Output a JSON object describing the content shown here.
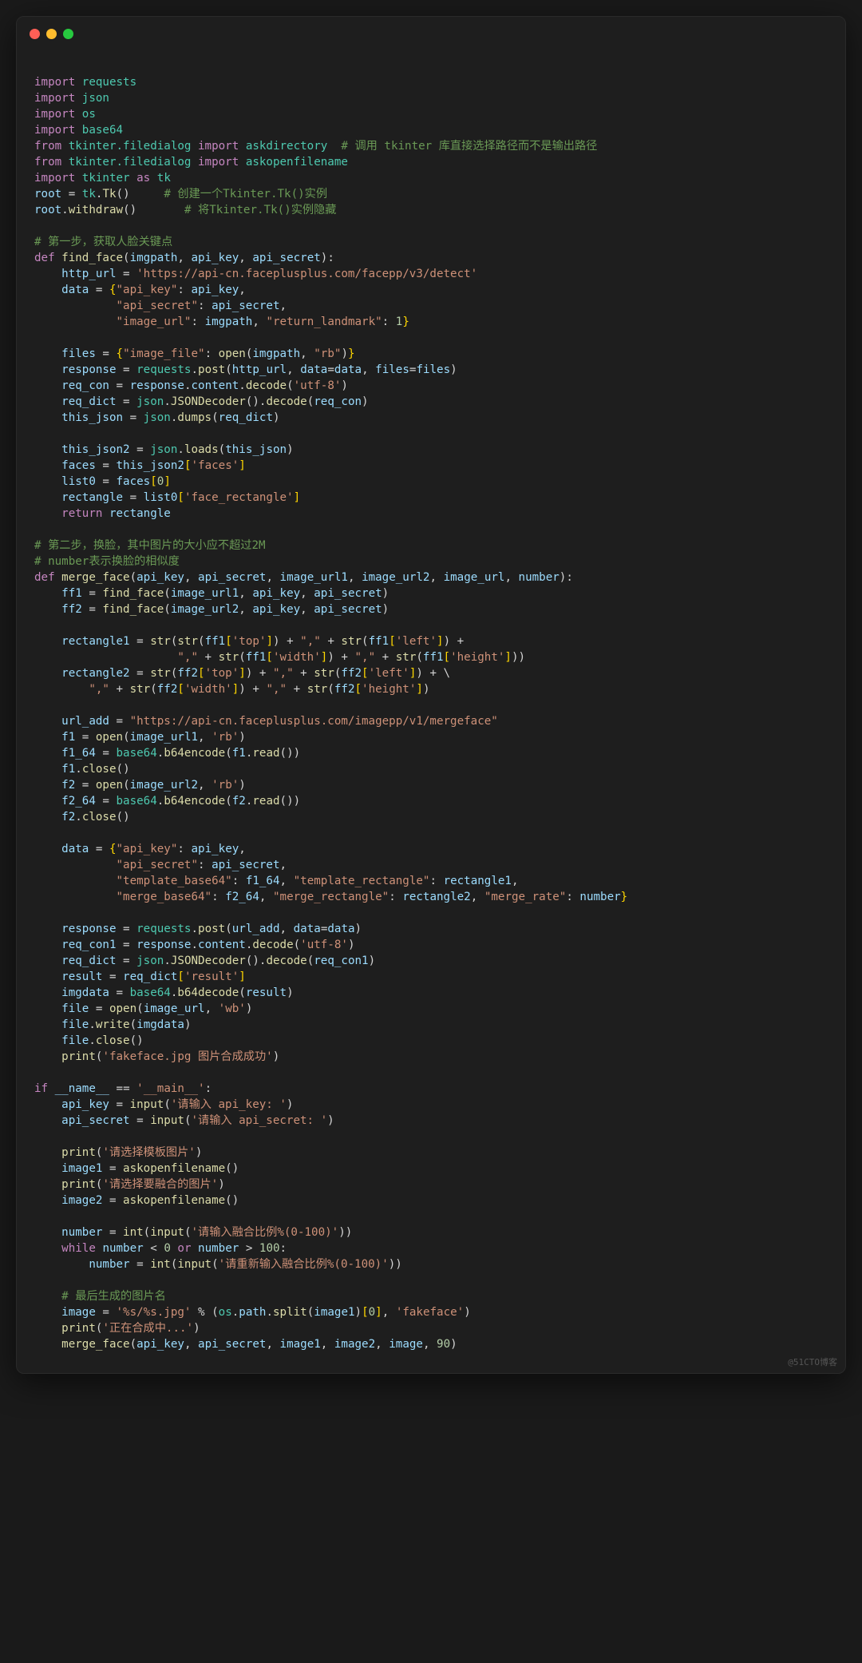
{
  "window": {
    "traffic_lights": [
      "red",
      "yellow",
      "green"
    ]
  },
  "watermark": "@51CTO博客",
  "code_lines": [
    "",
    "<span class='kw'>import</span> <span class='mod'>requests</span>",
    "<span class='kw'>import</span> <span class='mod'>json</span>",
    "<span class='kw'>import</span> <span class='mod'>os</span>",
    "<span class='kw'>import</span> <span class='mod'>base64</span>",
    "<span class='kw'>from</span> <span class='mod'>tkinter.filedialog</span> <span class='kw'>import</span> <span class='mod'>askdirectory</span>  <span class='cmt'># 调用 tkinter 库直接选择路径而不是输出路径</span>",
    "<span class='kw'>from</span> <span class='mod'>tkinter.filedialog</span> <span class='kw'>import</span> <span class='mod'>askopenfilename</span>",
    "<span class='kw'>import</span> <span class='mod'>tkinter</span> <span class='kw'>as</span> <span class='mod'>tk</span>",
    "<span class='var'>root</span> = <span class='mod'>tk</span>.<span class='fn'>Tk</span>()     <span class='cmt'># 创建一个Tkinter.Tk()实例</span>",
    "<span class='var'>root</span>.<span class='fn'>withdraw</span>()       <span class='cmt'># 将Tkinter.Tk()实例隐藏</span>",
    "",
    "<span class='cmt'># 第一步，获取人脸关键点</span>",
    "<span class='kw'>def</span> <span class='fn'>find_face</span>(<span class='var'>imgpath</span>, <span class='var'>api_key</span>, <span class='var'>api_secret</span>):",
    "    <span class='var'>http_url</span> = <span class='str'>'https://api-cn.faceplusplus.com/facepp/v3/detect'</span>",
    "    <span class='var'>data</span> = <span class='pun'>{</span><span class='str'>\"api_key\"</span>: <span class='var'>api_key</span>,",
    "            <span class='str'>\"api_secret\"</span>: <span class='var'>api_secret</span>,",
    "            <span class='str'>\"image_url\"</span>: <span class='var'>imgpath</span>, <span class='str'>\"return_landmark\"</span>: <span class='num'>1</span><span class='pun'>}</span>",
    "",
    "    <span class='var'>files</span> = <span class='pun'>{</span><span class='str'>\"image_file\"</span>: <span class='fn'>open</span>(<span class='var'>imgpath</span>, <span class='str'>\"rb\"</span>)<span class='pun'>}</span>",
    "    <span class='var'>response</span> = <span class='mod'>requests</span>.<span class='fn'>post</span>(<span class='var'>http_url</span>, <span class='var'>data</span>=<span class='var'>data</span>, <span class='var'>files</span>=<span class='var'>files</span>)",
    "    <span class='var'>req_con</span> = <span class='var'>response</span>.<span class='var'>content</span>.<span class='fn'>decode</span>(<span class='str'>'utf-8'</span>)",
    "    <span class='var'>req_dict</span> = <span class='mod'>json</span>.<span class='fn'>JSONDecoder</span>().<span class='fn'>decode</span>(<span class='var'>req_con</span>)",
    "    <span class='var'>this_json</span> = <span class='mod'>json</span>.<span class='fn'>dumps</span>(<span class='var'>req_dict</span>)",
    "",
    "    <span class='var'>this_json2</span> = <span class='mod'>json</span>.<span class='fn'>loads</span>(<span class='var'>this_json</span>)",
    "    <span class='var'>faces</span> = <span class='var'>this_json2</span><span class='pun'>[</span><span class='str'>'faces'</span><span class='pun'>]</span>",
    "    <span class='var'>list0</span> = <span class='var'>faces</span><span class='pun'>[</span><span class='num'>0</span><span class='pun'>]</span>",
    "    <span class='var'>rectangle</span> = <span class='var'>list0</span><span class='pun'>[</span><span class='str'>'face_rectangle'</span><span class='pun'>]</span>",
    "    <span class='kw'>return</span> <span class='var'>rectangle</span>",
    "",
    "<span class='cmt'># 第二步，换脸，其中图片的大小应不超过2M</span>",
    "<span class='cmt'># number表示换脸的相似度</span>",
    "<span class='kw'>def</span> <span class='fn'>merge_face</span>(<span class='var'>api_key</span>, <span class='var'>api_secret</span>, <span class='var'>image_url1</span>, <span class='var'>image_url2</span>, <span class='var'>image_url</span>, <span class='var'>number</span>):",
    "    <span class='var'>ff1</span> = <span class='fn'>find_face</span>(<span class='var'>image_url1</span>, <span class='var'>api_key</span>, <span class='var'>api_secret</span>)",
    "    <span class='var'>ff2</span> = <span class='fn'>find_face</span>(<span class='var'>image_url2</span>, <span class='var'>api_key</span>, <span class='var'>api_secret</span>)",
    "",
    "    <span class='var'>rectangle1</span> = <span class='fn'>str</span>(<span class='fn'>str</span>(<span class='var'>ff1</span><span class='pun'>[</span><span class='str'>'top'</span><span class='pun'>]</span>) + <span class='str'>\",\"</span> + <span class='fn'>str</span>(<span class='var'>ff1</span><span class='pun'>[</span><span class='str'>'left'</span><span class='pun'>]</span>) +",
    "                     <span class='str'>\",\"</span> + <span class='fn'>str</span>(<span class='var'>ff1</span><span class='pun'>[</span><span class='str'>'width'</span><span class='pun'>]</span>) + <span class='str'>\",\"</span> + <span class='fn'>str</span>(<span class='var'>ff1</span><span class='pun'>[</span><span class='str'>'height'</span><span class='pun'>]</span>))",
    "    <span class='var'>rectangle2</span> = <span class='fn'>str</span>(<span class='var'>ff2</span><span class='pun'>[</span><span class='str'>'top'</span><span class='pun'>]</span>) + <span class='str'>\",\"</span> + <span class='fn'>str</span>(<span class='var'>ff2</span><span class='pun'>[</span><span class='str'>'left'</span><span class='pun'>]</span>) + \\",
    "        <span class='str'>\",\"</span> + <span class='fn'>str</span>(<span class='var'>ff2</span><span class='pun'>[</span><span class='str'>'width'</span><span class='pun'>]</span>) + <span class='str'>\",\"</span> + <span class='fn'>str</span>(<span class='var'>ff2</span><span class='pun'>[</span><span class='str'>'height'</span><span class='pun'>]</span>)",
    "",
    "    <span class='var'>url_add</span> = <span class='str'>\"https://api-cn.faceplusplus.com/imagepp/v1/mergeface\"</span>",
    "    <span class='var'>f1</span> = <span class='fn'>open</span>(<span class='var'>image_url1</span>, <span class='str'>'rb'</span>)",
    "    <span class='var'>f1_64</span> = <span class='mod'>base64</span>.<span class='fn'>b64encode</span>(<span class='var'>f1</span>.<span class='fn'>read</span>())",
    "    <span class='var'>f1</span>.<span class='fn'>close</span>()",
    "    <span class='var'>f2</span> = <span class='fn'>open</span>(<span class='var'>image_url2</span>, <span class='str'>'rb'</span>)",
    "    <span class='var'>f2_64</span> = <span class='mod'>base64</span>.<span class='fn'>b64encode</span>(<span class='var'>f2</span>.<span class='fn'>read</span>())",
    "    <span class='var'>f2</span>.<span class='fn'>close</span>()",
    "",
    "    <span class='var'>data</span> = <span class='pun'>{</span><span class='str'>\"api_key\"</span>: <span class='var'>api_key</span>,",
    "            <span class='str'>\"api_secret\"</span>: <span class='var'>api_secret</span>,",
    "            <span class='str'>\"template_base64\"</span>: <span class='var'>f1_64</span>, <span class='str'>\"template_rectangle\"</span>: <span class='var'>rectangle1</span>,",
    "            <span class='str'>\"merge_base64\"</span>: <span class='var'>f2_64</span>, <span class='str'>\"merge_rectangle\"</span>: <span class='var'>rectangle2</span>, <span class='str'>\"merge_rate\"</span>: <span class='var'>number</span><span class='pun'>}</span>",
    "",
    "    <span class='var'>response</span> = <span class='mod'>requests</span>.<span class='fn'>post</span>(<span class='var'>url_add</span>, <span class='var'>data</span>=<span class='var'>data</span>)",
    "    <span class='var'>req_con1</span> = <span class='var'>response</span>.<span class='var'>content</span>.<span class='fn'>decode</span>(<span class='str'>'utf-8'</span>)",
    "    <span class='var'>req_dict</span> = <span class='mod'>json</span>.<span class='fn'>JSONDecoder</span>().<span class='fn'>decode</span>(<span class='var'>req_con1</span>)",
    "    <span class='var'>result</span> = <span class='var'>req_dict</span><span class='pun'>[</span><span class='str'>'result'</span><span class='pun'>]</span>",
    "    <span class='var'>imgdata</span> = <span class='mod'>base64</span>.<span class='fn'>b64decode</span>(<span class='var'>result</span>)",
    "    <span class='var'>file</span> = <span class='fn'>open</span>(<span class='var'>image_url</span>, <span class='str'>'wb'</span>)",
    "    <span class='var'>file</span>.<span class='fn'>write</span>(<span class='var'>imgdata</span>)",
    "    <span class='var'>file</span>.<span class='fn'>close</span>()",
    "    <span class='fn'>print</span>(<span class='str'>'fakeface.jpg 图片合成成功'</span>)",
    "",
    "<span class='kw'>if</span> <span class='var'>__name__</span> == <span class='str'>'__main__'</span>:",
    "    <span class='var'>api_key</span> = <span class='fn'>input</span>(<span class='str'>'请输入 api_key: '</span>)",
    "    <span class='var'>api_secret</span> = <span class='fn'>input</span>(<span class='str'>'请输入 api_secret: '</span>)",
    "",
    "    <span class='fn'>print</span>(<span class='str'>'请选择模板图片'</span>)",
    "    <span class='var'>image1</span> = <span class='fn'>askopenfilename</span>()",
    "    <span class='fn'>print</span>(<span class='str'>'请选择要融合的图片'</span>)",
    "    <span class='var'>image2</span> = <span class='fn'>askopenfilename</span>()",
    "",
    "    <span class='var'>number</span> = <span class='fn'>int</span>(<span class='fn'>input</span>(<span class='str'>'请输入融合比例%(0-100)'</span>))",
    "    <span class='kw'>while</span> <span class='var'>number</span> &lt; <span class='num'>0</span> <span class='kw'>or</span> <span class='var'>number</span> &gt; <span class='num'>100</span>:",
    "        <span class='var'>number</span> = <span class='fn'>int</span>(<span class='fn'>input</span>(<span class='str'>'请重新输入融合比例%(0-100)'</span>))",
    "",
    "    <span class='cmt'># 最后生成的图片名</span>",
    "    <span class='var'>image</span> = <span class='str'>'%s/%s.jpg'</span> % (<span class='mod'>os</span>.<span class='var'>path</span>.<span class='fn'>split</span>(<span class='var'>image1</span>)<span class='pun'>[</span><span class='num'>0</span><span class='pun'>]</span>, <span class='str'>'fakeface'</span>)",
    "    <span class='fn'>print</span>(<span class='str'>'正在合成中...'</span>)",
    "    <span class='fn'>merge_face</span>(<span class='var'>api_key</span>, <span class='var'>api_secret</span>, <span class='var'>image1</span>, <span class='var'>image2</span>, <span class='var'>image</span>, <span class='num'>90</span>)"
  ]
}
